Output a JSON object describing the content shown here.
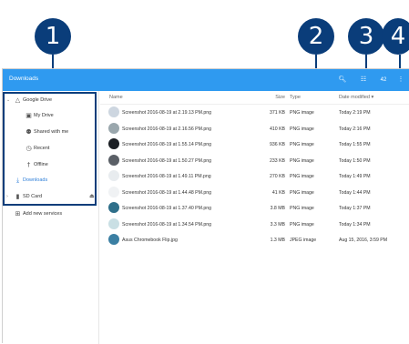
{
  "callouts": [
    "1",
    "2",
    "3",
    "4"
  ],
  "appbar": {
    "title": "Downloads",
    "search_icon": "search-icon",
    "grid_icon": "grid-view-icon",
    "zoom": "42",
    "menu_icon": "more-vert-icon"
  },
  "sidebar": {
    "items": [
      {
        "label": "Google Drive",
        "icon": "drive-icon"
      },
      {
        "label": "My Drive",
        "icon": "folder-icon"
      },
      {
        "label": "Shared with me",
        "icon": "people-icon"
      },
      {
        "label": "Recent",
        "icon": "clock-icon"
      },
      {
        "label": "Offline",
        "icon": "pin-icon"
      },
      {
        "label": "Downloads",
        "icon": "download-icon"
      },
      {
        "label": "SD Card",
        "icon": "sd-card-icon"
      },
      {
        "label": "Add new services",
        "icon": "add-box-icon"
      }
    ]
  },
  "table": {
    "headers": {
      "name": "Name",
      "size": "Size",
      "type": "Type",
      "date": "Date modified ▾"
    },
    "rows": [
      {
        "name": "Screenshot 2016-08-19 at 2.19.13 PM.png",
        "size": "371 KB",
        "type": "PNG image",
        "date": "Today 2:19 PM",
        "thumb": "#cdd6e0"
      },
      {
        "name": "Screenshot 2016-08-19 at 2.16.56 PM.png",
        "size": "410 KB",
        "type": "PNG image",
        "date": "Today 2:16 PM",
        "thumb": "#9aa7ad"
      },
      {
        "name": "Screenshot 2016-08-19 at 1.55.14 PM.png",
        "size": "936 KB",
        "type": "PNG image",
        "date": "Today 1:55 PM",
        "thumb": "#1b1f24"
      },
      {
        "name": "Screenshot 2016-08-19 at 1.50.27 PM.png",
        "size": "233 KB",
        "type": "PNG image",
        "date": "Today 1:50 PM",
        "thumb": "#5a5f66"
      },
      {
        "name": "Screenshot 2016-08-19 at 1.49.11 PM.png",
        "size": "270 KB",
        "type": "PNG image",
        "date": "Today 1:49 PM",
        "thumb": "#e8ecef"
      },
      {
        "name": "Screenshot 2016-08-19 at 1.44.48 PM.png",
        "size": "41 KB",
        "type": "PNG image",
        "date": "Today 1:44 PM",
        "thumb": "#f0f2f4"
      },
      {
        "name": "Screenshot 2016-08-19 at 1.37.40 PM.png",
        "size": "3.8 MB",
        "type": "PNG image",
        "date": "Today 1:37 PM",
        "thumb": "#2f6f8a"
      },
      {
        "name": "Screenshot 2016-08-19 at 1.34.54 PM.png",
        "size": "3.3 MB",
        "type": "PNG image",
        "date": "Today 1:34 PM",
        "thumb": "#c9dfe4"
      },
      {
        "name": "Asus Chromebook Flip.jpg",
        "size": "1.3 MB",
        "type": "JPEG image",
        "date": "Aug 15, 2016, 3:59 PM",
        "thumb": "#3b7fa3"
      }
    ]
  }
}
